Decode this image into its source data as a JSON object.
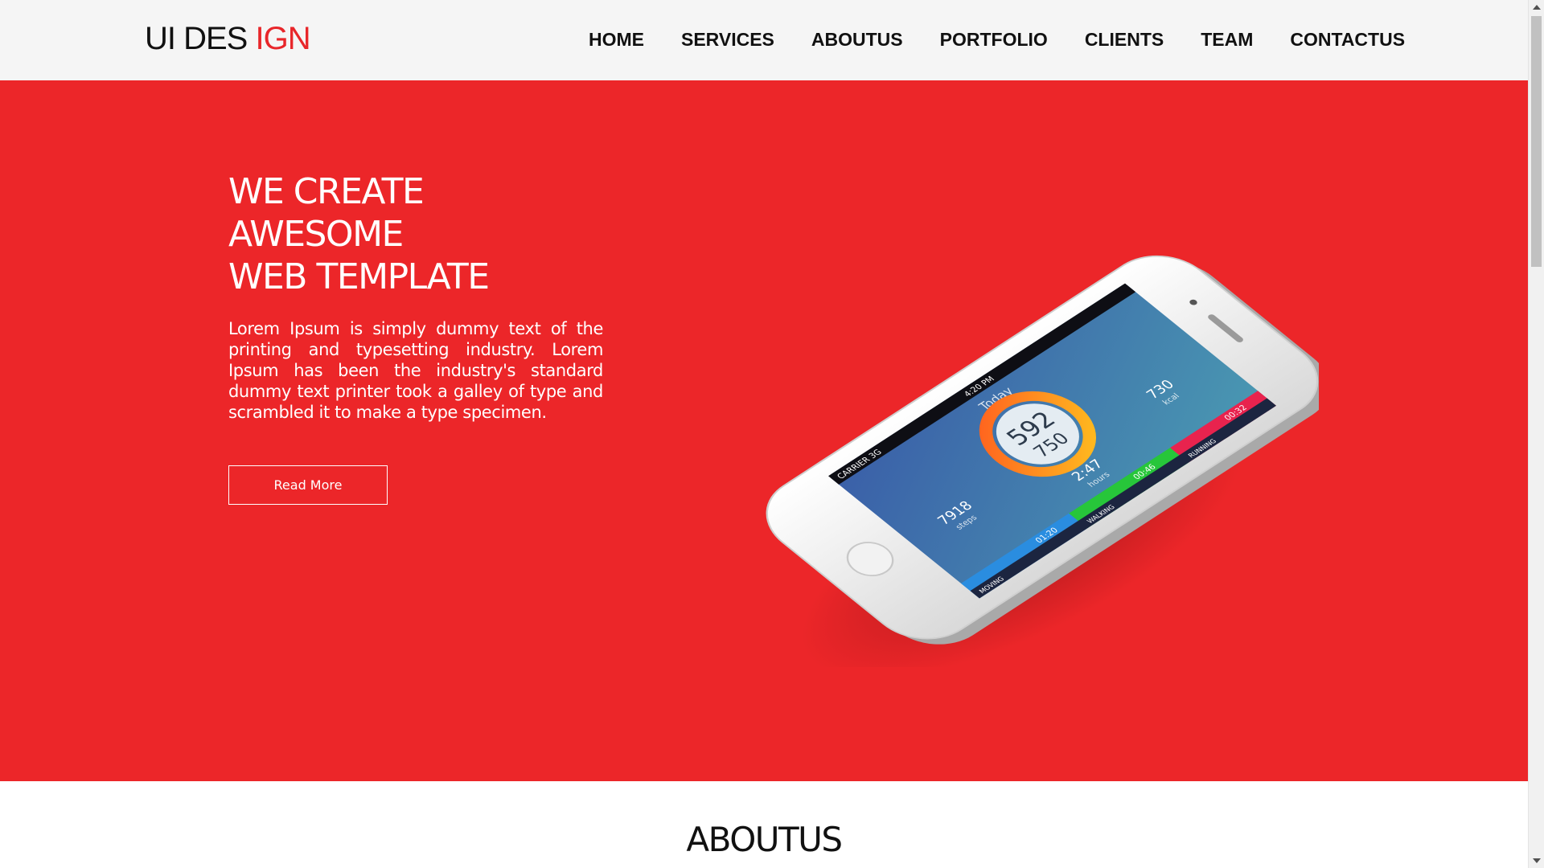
{
  "header": {
    "logo": {
      "part1": "UI DES ",
      "part2": "IGN"
    },
    "nav": [
      "HOME",
      "SERVICES",
      "ABOUTUS",
      "PORTFOLIO",
      "CLIENTS",
      "TEAM",
      "CONTACTUS"
    ]
  },
  "hero": {
    "title_lines": [
      "WE CREATE",
      "AWESOME",
      "WEB TEMPLATE"
    ],
    "text": "Lorem Ipsum is simply dummy text of the printing and typesetting industry. Lorem Ipsum has been the industry's standard dummy text printer took a galley of type and scrambled it to make a type specimen.",
    "button": "Read More",
    "phone": {
      "carrier": "CARRIER 3G",
      "time": "4:20 PM",
      "today": "Today",
      "main_value": "592",
      "main_target": "750",
      "stats": [
        {
          "value": "7918",
          "label": "steps"
        },
        {
          "value": "2:47",
          "label": "hours"
        },
        {
          "value": "730",
          "label": "kcal"
        }
      ],
      "activities": [
        {
          "label": "MOVING",
          "time": "01:20",
          "color": "#2a8de0"
        },
        {
          "label": "WALKING",
          "time": "00:46",
          "color": "#27c63a"
        },
        {
          "label": "RUNNING",
          "time": "00:32",
          "color": "#e8234e"
        }
      ]
    }
  },
  "about": {
    "title": "ABOUTUS"
  },
  "colors": {
    "accent": "#ec2629",
    "header_bg": "#f5f5f5"
  }
}
